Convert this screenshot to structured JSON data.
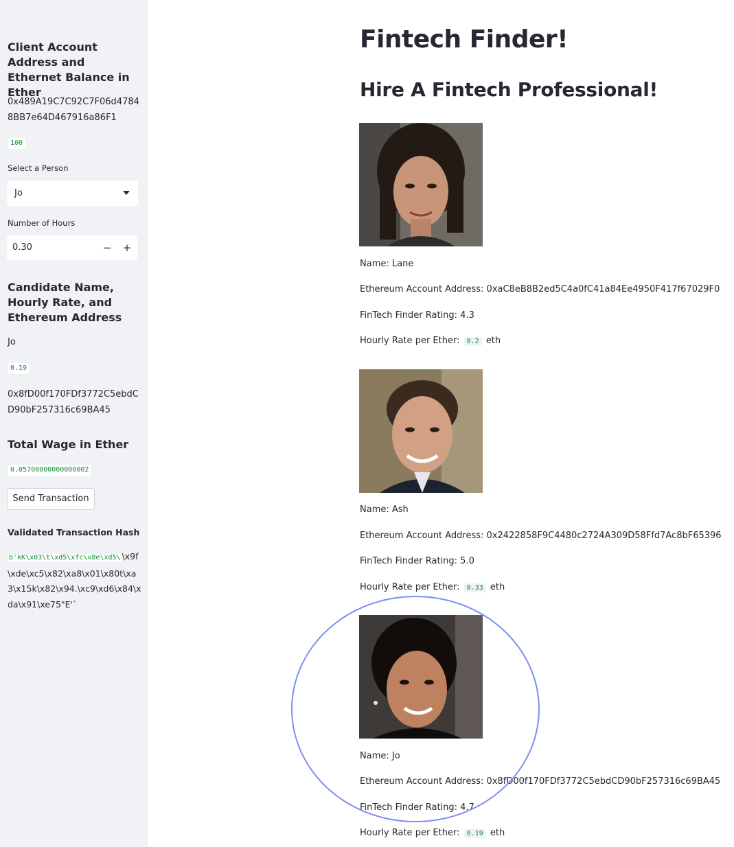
{
  "sidebar": {
    "client_heading": "Client Account Address and Ethernet Balance in Ether",
    "client_address": "0x489A19C7C92C7F06d47848BB7e64D467916a86F1",
    "client_balance": "100",
    "select_label": "Select a Person",
    "select_value": "Jo",
    "hours_label": "Number of Hours",
    "hours_value": "0.30",
    "hours_minus": "−",
    "hours_plus": "+",
    "candidate_heading": "Candidate Name, Hourly Rate, and Ethereum Address",
    "candidate_name": "Jo",
    "candidate_rate": "0.19",
    "candidate_address": "0x8fD00f170FDf3772C5ebdCD90bF257316c69BA45",
    "wage_heading": "Total Wage in Ether",
    "wage_value": "0.05700000000000002",
    "send_button": "Send Transaction",
    "hash_heading": "Validated Transaction Hash",
    "hash_code": "b'kK\\x03\\t\\xd5\\xfc\\x8e\\xd5\\",
    "hash_rest": "\\x9f\\xde\\xc5\\x82\\xa8\\x01\\x80t\\xa3\\x15k\\x82\\x94.\\xc9\\xd6\\x84\\xda\\x91\\xe75\"E'`"
  },
  "main": {
    "title": "Fintech Finder!",
    "subtitle": "Hire A Fintech Professional!",
    "labels": {
      "name": "Name: ",
      "address": "Ethereum Account Address: ",
      "rating": "FinTech Finder Rating: ",
      "rate": "Hourly Rate per Ether: ",
      "unit": "eth"
    },
    "candidates": [
      {
        "name": "Lane",
        "address": "0xaC8eB8B2ed5C4a0fC41a84Ee4950F417f67029F0",
        "rating": "4.3",
        "rate": "0.2"
      },
      {
        "name": "Ash",
        "address": "0x2422858F9C4480c2724A309D58Ffd7Ac8bF65396",
        "rating": "5.0",
        "rate": "0.33"
      },
      {
        "name": "Jo",
        "address": "0x8fD00f170FDf3772C5ebdCD90bF257316c69BA45",
        "rating": "4.7",
        "rate": "0.19"
      }
    ]
  },
  "colors": {
    "sidebar_bg": "#f0f2f6",
    "code_text": "#0f8a2e",
    "annotation_circle": "#7a8ff0"
  }
}
